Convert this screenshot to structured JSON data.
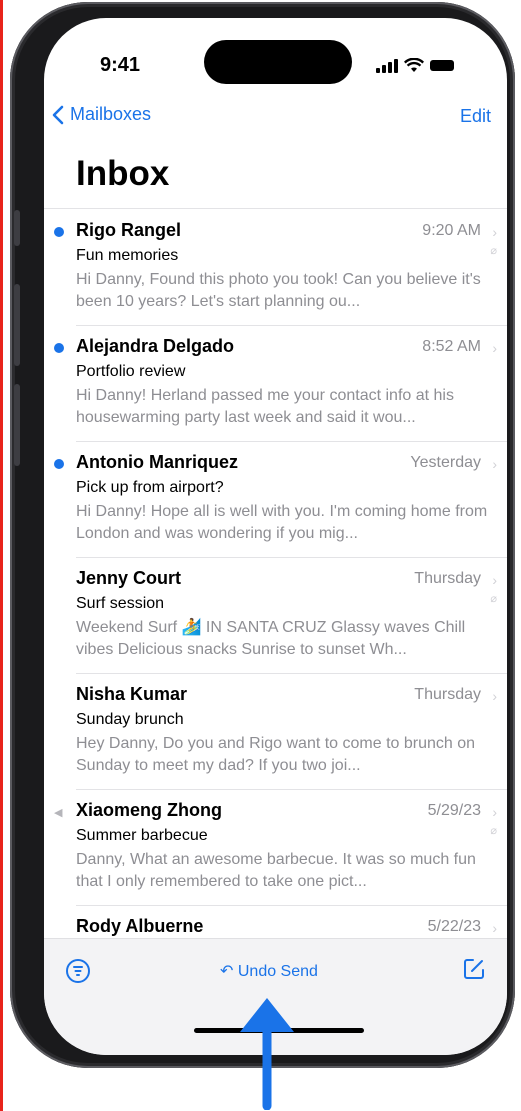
{
  "status": {
    "time": "9:41"
  },
  "nav": {
    "back_label": "Mailboxes",
    "edit_label": "Edit",
    "title": "Inbox"
  },
  "messages": [
    {
      "sender": "Rigo Rangel",
      "time": "9:20 AM",
      "subject": "Fun memories",
      "preview": "Hi Danny, Found this photo you took! Can you believe it's been 10 years? Let's start planning ou...",
      "unread": true,
      "attachment": true
    },
    {
      "sender": "Alejandra Delgado",
      "time": "8:52 AM",
      "subject": "Portfolio review",
      "preview": "Hi Danny! Herland passed me your contact info at his housewarming party last week and said it wou...",
      "unread": true,
      "attachment": false
    },
    {
      "sender": "Antonio Manriquez",
      "time": "Yesterday",
      "subject": "Pick up from airport?",
      "preview": "Hi Danny! Hope all is well with you. I'm coming home from London and was wondering if you mig...",
      "unread": true,
      "attachment": false
    },
    {
      "sender": "Jenny Court",
      "time": "Thursday",
      "subject": "Surf session",
      "preview": "Weekend Surf 🏄 IN SANTA CRUZ Glassy waves Chill vibes Delicious snacks Sunrise to sunset Wh...",
      "unread": false,
      "attachment": true
    },
    {
      "sender": "Nisha Kumar",
      "time": "Thursday",
      "subject": "Sunday brunch",
      "preview": "Hey Danny, Do you and Rigo want to come to brunch on Sunday to meet my dad? If you two joi...",
      "unread": false,
      "attachment": false
    },
    {
      "sender": "Xiaomeng Zhong",
      "time": "5/29/23",
      "subject": "Summer barbecue",
      "preview": "Danny, What an awesome barbecue. It was so much fun that I only remembered to take one pict...",
      "unread": false,
      "replied": true,
      "attachment": true
    },
    {
      "sender": "Rody Albuerne",
      "time": "5/22/23",
      "subject": "",
      "preview": "",
      "unread": false,
      "attachment": false
    }
  ],
  "toolbar": {
    "undo_label": "Undo Send"
  },
  "colors": {
    "accent": "#1a73e8",
    "secondary_text": "#8e8e93",
    "toolbar_bg": "#f3f3f5",
    "callout_arrow": "#1a73e8"
  }
}
